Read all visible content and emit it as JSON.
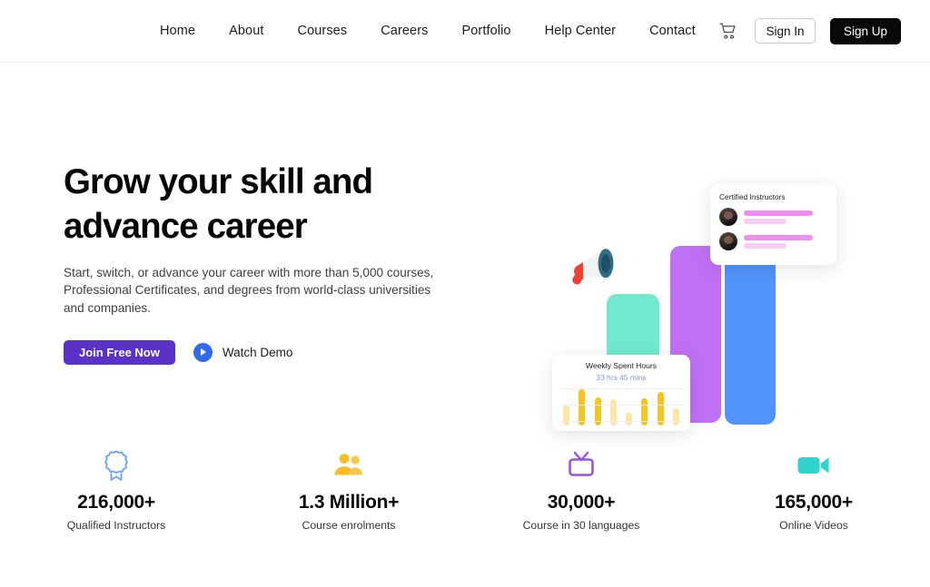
{
  "header": {
    "nav_items": [
      {
        "label": "Home"
      },
      {
        "label": "About"
      },
      {
        "label": "Courses"
      },
      {
        "label": "Careers"
      },
      {
        "label": "Portfolio"
      },
      {
        "label": "Help Center"
      },
      {
        "label": "Contact"
      }
    ],
    "cart_icon": "shopping-cart-icon",
    "sign_in_label": "Sign In",
    "sign_up_label": "Sign Up",
    "sign_up_bg": "#090909"
  },
  "hero": {
    "title": "Grow your skill and\nadvance career",
    "subtitle": "Start, switch, or advance your career with more than 5,000 courses,\nProfessional Certificates, and degrees from world-class universities\nand companies.",
    "primary_cta": "Join Free Now",
    "primary_cta_bg": "#5a33c6",
    "secondary_cta": "Watch Demo",
    "play_icon": "play-icon",
    "play_icon_bg": "#2f6bea"
  },
  "illustration": {
    "megaphone_icon": "megaphone-icon",
    "bars": [
      {
        "name": "mint-bar",
        "color": "#72e8cf"
      },
      {
        "name": "purple-bar",
        "color": "#c070f5"
      },
      {
        "name": "blue-bar",
        "color": "#5193fa"
      }
    ],
    "instructors_card": {
      "title": "Certified Instructors",
      "accent": "#ef8df0",
      "accent_soft": "#f8cdf7",
      "rows": 2
    },
    "weekly_card": {
      "title": "Weekly Spent Hours",
      "value": "33 hrs 45 mins",
      "value_color": "#7e93e8",
      "bar_dark": "#f6c51d",
      "bar_light": "#fbe6a6",
      "bars": [
        {
          "height": 22,
          "tone": "light"
        },
        {
          "height": 40,
          "tone": "dark"
        },
        {
          "height": 31,
          "tone": "dark"
        },
        {
          "height": 29,
          "tone": "light"
        },
        {
          "height": 14,
          "tone": "light"
        },
        {
          "height": 30,
          "tone": "dark"
        },
        {
          "height": 37,
          "tone": "dark"
        },
        {
          "height": 19,
          "tone": "light"
        }
      ]
    }
  },
  "stats": [
    {
      "icon": "award-badge-icon",
      "icon_color": "#5b9bf0",
      "value": "216,000+",
      "label": "Qualified Instructors"
    },
    {
      "icon": "people-icon",
      "icon_color": "#f7bf1f",
      "value": "1.3 Million+",
      "label": "Course enrolments"
    },
    {
      "icon": "television-icon",
      "icon_color": "#9b51e0",
      "value": "30,000+",
      "label": "Course in 30 languages"
    },
    {
      "icon": "video-camera-icon",
      "icon_color": "#2fd4cd",
      "value": "165,000+",
      "label": "Online Videos"
    }
  ]
}
